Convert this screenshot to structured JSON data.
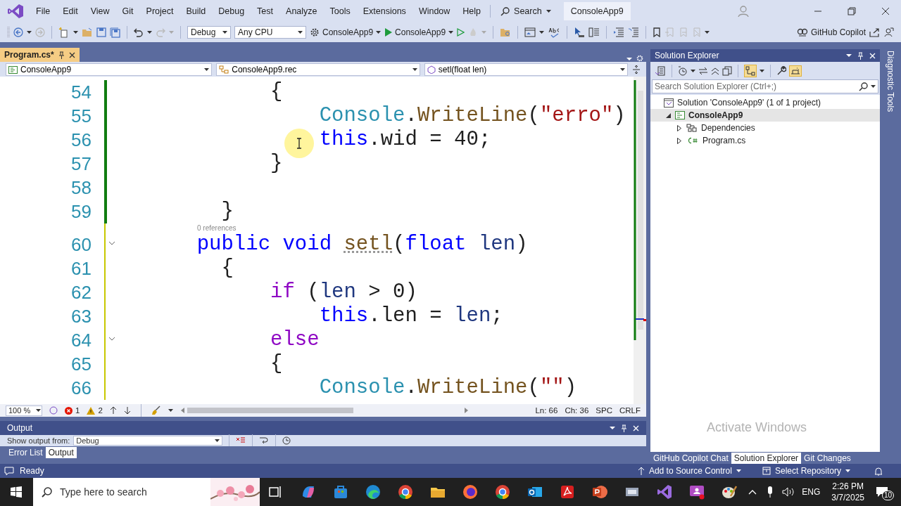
{
  "title_bar": {
    "menu": [
      "File",
      "Edit",
      "View",
      "Git",
      "Project",
      "Build",
      "Debug",
      "Test",
      "Analyze",
      "Tools",
      "Extensions",
      "Window",
      "Help"
    ],
    "search": "Search",
    "solution_name": "ConsoleApp9"
  },
  "toolbar": {
    "configuration": "Debug",
    "platform": "Any CPU",
    "startup_project": "ConsoleApp9",
    "run_target": "ConsoleApp9",
    "copilot": "GitHub Copilot"
  },
  "document_tabs": [
    {
      "label": "Program.cs*",
      "selected": true
    }
  ],
  "navigation_bar": [
    "ConsoleApp9",
    "ConsoleApp9.rec",
    "setl(float len)"
  ],
  "editor": {
    "lines": [
      {
        "number": "54",
        "unsaved": false,
        "fold": false,
        "tokens": [
          {
            "kind": "plain",
            "text": "          {"
          }
        ]
      },
      {
        "number": "55",
        "unsaved": false,
        "fold": false,
        "tokens": [
          {
            "kind": "type",
            "text": "              Console"
          },
          {
            "kind": "plain",
            "text": "."
          },
          {
            "kind": "method",
            "text": "WriteLine"
          },
          {
            "kind": "plain",
            "text": "("
          },
          {
            "kind": "str",
            "text": "\"erro\""
          },
          {
            "kind": "plain",
            "text": ")"
          }
        ]
      },
      {
        "number": "56",
        "unsaved": false,
        "fold": false,
        "tokens": [
          {
            "kind": "kw",
            "text": "              this"
          },
          {
            "kind": "plain",
            "text": ".wid = 40;"
          }
        ]
      },
      {
        "number": "57",
        "unsaved": false,
        "fold": false,
        "tokens": [
          {
            "kind": "plain",
            "text": "          }"
          }
        ]
      },
      {
        "number": "58",
        "unsaved": false,
        "fold": false
      },
      {
        "number": "59",
        "unsaved": false,
        "fold": false,
        "tokens": [
          {
            "kind": "plain",
            "text": "      }"
          }
        ]
      },
      {
        "number": "60",
        "unsaved": true,
        "fold": true,
        "codelens": "0 references",
        "tokens": [
          {
            "kind": "kw",
            "text": "    public void "
          },
          {
            "kind": "hinted",
            "text": "setl"
          },
          {
            "kind": "plain",
            "text": "("
          },
          {
            "kind": "kw",
            "text": "float "
          },
          {
            "kind": "param",
            "text": "len"
          },
          {
            "kind": "plain",
            "text": ")"
          }
        ]
      },
      {
        "number": "61",
        "unsaved": true,
        "fold": false,
        "tokens": [
          {
            "kind": "plain",
            "text": "      {"
          }
        ]
      },
      {
        "number": "62",
        "unsaved": true,
        "fold": false,
        "tokens": [
          {
            "kind": "control",
            "text": "          if"
          },
          {
            "kind": "plain",
            "text": " ("
          },
          {
            "kind": "param",
            "text": "len"
          },
          {
            "kind": "plain",
            "text": " > 0)"
          }
        ]
      },
      {
        "number": "63",
        "unsaved": true,
        "fold": false,
        "tokens": [
          {
            "kind": "kw",
            "text": "              this"
          },
          {
            "kind": "plain",
            "text": ".len = "
          },
          {
            "kind": "param",
            "text": "len"
          },
          {
            "kind": "plain",
            "text": ";"
          }
        ]
      },
      {
        "number": "64",
        "unsaved": true,
        "fold": true,
        "tokens": [
          {
            "kind": "control",
            "text": "          else"
          }
        ]
      },
      {
        "number": "65",
        "unsaved": true,
        "fold": false,
        "tokens": [
          {
            "kind": "plain",
            "text": "          {"
          }
        ]
      },
      {
        "number": "66",
        "unsaved": true,
        "fold": false,
        "tokens": [
          {
            "kind": "type",
            "text": "              Console"
          },
          {
            "kind": "plain",
            "text": "."
          },
          {
            "kind": "method",
            "text": "WriteLine"
          },
          {
            "kind": "plain",
            "text": "("
          },
          {
            "kind": "str",
            "text": "\"\""
          },
          {
            "kind": "plain",
            "text": ")"
          }
        ]
      }
    ]
  },
  "editor_status": {
    "zoom": "100 %",
    "errors": "1",
    "warnings": "2",
    "line": "Ln: 66",
    "column": "Ch: 36",
    "whitespace": "SPC",
    "line_ending": "CRLF"
  },
  "output_panel": {
    "title": "Output",
    "show_output_from": "Show output from:",
    "source": "Debug"
  },
  "bottom_tabs": [
    {
      "label": "Error List",
      "selected": false
    },
    {
      "label": "Output",
      "selected": true
    }
  ],
  "solution_explorer": {
    "title": "Solution Explorer",
    "search_placeholder": "Search Solution Explorer (Ctrl+;)",
    "toggles": [
      {
        "kind": "diagram",
        "on": true
      },
      {
        "kind": "preview",
        "on": true
      }
    ],
    "tree": [
      {
        "label": "Solution 'ConsoleApp9' (1 of 1 project)",
        "kind": "solution",
        "selected": false,
        "children": [
          {
            "label": "ConsoleApp9",
            "kind": "project",
            "expanded": true,
            "selected": true,
            "children": [
              {
                "label": "Dependencies",
                "kind": "dependencies",
                "expanded": false,
                "selected": false
              },
              {
                "label": "Program.cs",
                "kind": "csharp",
                "expanded": false,
                "selected": false
              }
            ]
          }
        ]
      }
    ]
  },
  "side_tab": "Diagnostic Tools",
  "right_tabs": [
    {
      "label": "GitHub Copilot Chat",
      "selected": false
    },
    {
      "label": "Solution Explorer",
      "selected": true
    },
    {
      "label": "Git Changes",
      "selected": false
    }
  ],
  "os_notice": "Activate Windows",
  "status_bar": {
    "state": "Ready",
    "source_control": "Add to Source Control",
    "repository": "Select Repository"
  },
  "taskbar": {
    "search_placeholder": "Type here to search",
    "language": "ENG",
    "time": "2:26 PM",
    "date": "3/7/2025",
    "notifications": "10"
  }
}
